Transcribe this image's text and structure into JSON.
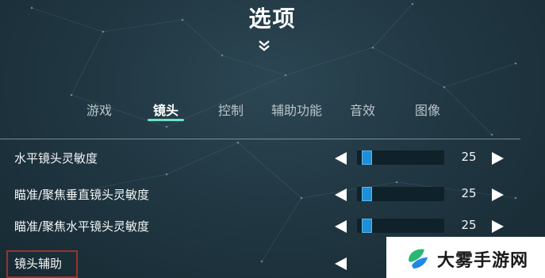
{
  "screen": {
    "title": "选项"
  },
  "tabs": [
    {
      "label": "游戏",
      "active": false
    },
    {
      "label": "镜头",
      "active": true
    },
    {
      "label": "控制",
      "active": false
    },
    {
      "label": "辅助功能",
      "active": false
    },
    {
      "label": "音效",
      "active": false
    },
    {
      "label": "图像",
      "active": false
    }
  ],
  "settings": [
    {
      "label": "水平镜头灵敏度",
      "value": "25"
    },
    {
      "label": "瞄准/聚焦垂直镜头灵敏度",
      "value": "25"
    },
    {
      "label": "瞄准/聚焦水平镜头灵敏度",
      "value": "25"
    },
    {
      "label": "镜头辅助"
    }
  ],
  "watermark": {
    "text": "大雾手游网"
  },
  "colors": {
    "accent": "#6ee0c8",
    "slider_thumb": "#1f8fd8",
    "background": "#1f3540"
  },
  "icons": {
    "expand": "double-chevron-down-icon",
    "decrease": "arrow-left-icon",
    "increase": "arrow-right-icon"
  }
}
